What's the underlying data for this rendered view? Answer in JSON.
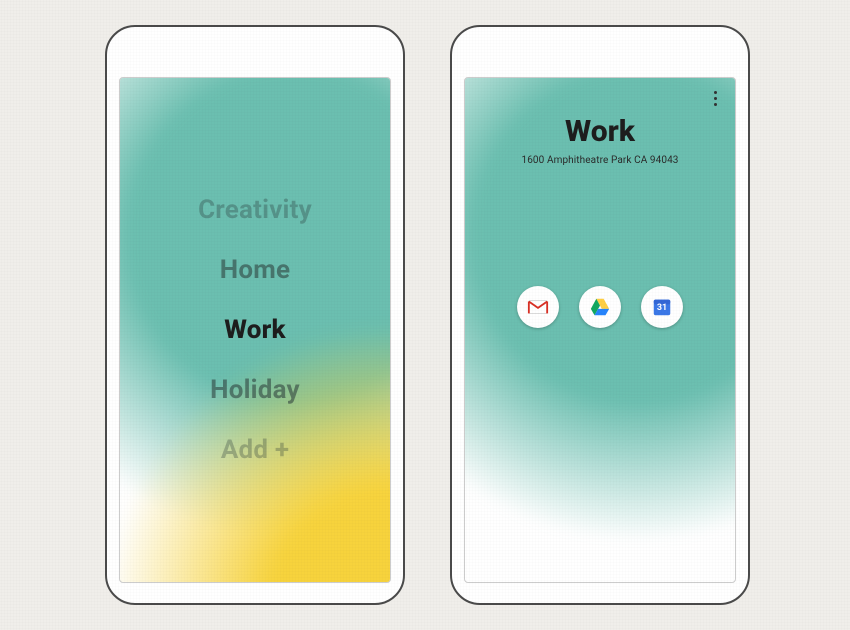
{
  "left_phone": {
    "modes": [
      {
        "label": "Creativity",
        "state": "fade-1"
      },
      {
        "label": "Home",
        "state": "fade-2"
      },
      {
        "label": "Work",
        "state": "selected"
      },
      {
        "label": "Holiday",
        "state": "fade-3"
      },
      {
        "label": "Add +",
        "state": "fade-4"
      }
    ]
  },
  "right_phone": {
    "title": "Work",
    "subtitle": "1600 Amphitheatre Park CA 94043",
    "menu_icon": "more-vertical-icon",
    "apps": [
      {
        "name": "gmail-icon",
        "label": "Gmail"
      },
      {
        "name": "drive-icon",
        "label": "Drive"
      },
      {
        "name": "calendar-icon",
        "label": "Calendar",
        "day": "31"
      }
    ]
  },
  "colors": {
    "teal": "#6bbfb0",
    "yellow": "#f7d33c",
    "paper": "#f0eeea"
  }
}
